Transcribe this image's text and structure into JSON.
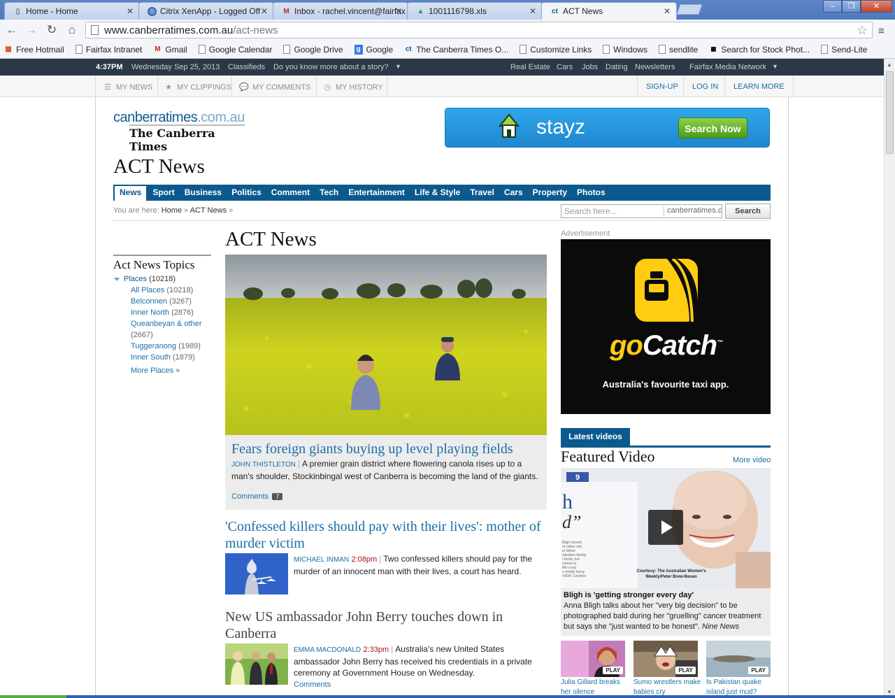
{
  "tabs": [
    {
      "title": "Home - Home",
      "icon": "doc-icon"
    },
    {
      "title": "Citrix XenApp - Logged Off",
      "icon": "citrix-icon"
    },
    {
      "title": "Inbox - rachel.vincent@fairfax",
      "icon": "gmail-icon"
    },
    {
      "title": "1001116798.xls",
      "icon": "drive-icon"
    },
    {
      "title": "ACT News",
      "icon": "ct-icon"
    }
  ],
  "address": {
    "host": "www.canberratimes.com.au",
    "path": "/act-news"
  },
  "bookmarks": [
    "Free Hotmail",
    "Fairfax Intranet",
    "Gmail",
    "Google Calendar",
    "Google Drive",
    "Google",
    "The Canberra Times O...",
    "Customize Links",
    "Windows",
    "sendlite",
    "Search for Stock Phot...",
    "Send-Lite"
  ],
  "topbar": {
    "time": "4:37PM",
    "date": "Wednesday Sep 25, 2013",
    "classifieds": "Classifieds",
    "story": "Do you know more about a story?",
    "links": [
      "Real Estate",
      "Cars",
      "Jobs",
      "Dating",
      "Newsletters"
    ],
    "network": "Fairfax Media Network"
  },
  "userbar": {
    "items": [
      "MY NEWS",
      "MY CLIPPINGS",
      "MY COMMENTS",
      "MY HISTORY"
    ],
    "signup": "SIGN-UP",
    "login": "LOG IN",
    "learn": "LEARN MORE"
  },
  "logo": {
    "domain": "canberratimes",
    "tld": ".com.au",
    "masthead": "The Canberra Times"
  },
  "stayz": {
    "brand": "stayz",
    "cta": "Search Now"
  },
  "section_title": "ACT News",
  "nav": [
    "News",
    "Sport",
    "Business",
    "Politics",
    "Comment",
    "Tech",
    "Entertainment",
    "Life & Style",
    "Travel",
    "Cars",
    "Property",
    "Photos"
  ],
  "breadcrumb": {
    "prefix": "You are here:",
    "home": "Home",
    "current": "ACT News"
  },
  "search": {
    "placeholder": "Search here...",
    "site": "canberratimes.com.au",
    "button": "Search"
  },
  "topics": {
    "heading": "Act News Topics",
    "places_label": "Places",
    "places_count": "(10218)",
    "items": [
      {
        "label": "All Places",
        "count": "(10218)"
      },
      {
        "label": "Belconnen",
        "count": "(3267)"
      },
      {
        "label": "Inner North",
        "count": "(2876)"
      },
      {
        "label": "Queanbeyan & other",
        "count": "(2667)"
      },
      {
        "label": "Tuggeranong",
        "count": "(1989)"
      },
      {
        "label": "Inner South",
        "count": "(1879)"
      }
    ],
    "more": "More Places »"
  },
  "main_title": "ACT News",
  "hero": {
    "headline": "Fears foreign giants buying up level playing fields",
    "author": "JOHN THISTLETON",
    "summary": "A premier grain district where flowering canola rises up to a man's shoulder, Stockinbingal west of Canberra is becoming the land of the giants.",
    "comments": "Comments",
    "comment_count": "7"
  },
  "stories": [
    {
      "headline": "'Confessed killers should pay with their lives': mother of murder victim",
      "author": "MICHAEL INMAN",
      "time": "2:08pm",
      "summary": "Two confessed killers should pay for the murder of an innocent man with their lives, a court has heard."
    },
    {
      "headline": "New US ambassador John Berry touches down in Canberra",
      "author": "EMMA MACDONALD",
      "time": "2:33pm",
      "summary": "Australia's new United States ambassador John Berry has received his credentials in a private ceremony at Government House on Wednesday.",
      "comments": "Comments"
    }
  ],
  "ad": {
    "label": "Advertisement",
    "brand_go": "go",
    "brand_catch": "Catch",
    "tm": "™",
    "tagline": "Australia's favourite taxi app."
  },
  "videos": {
    "tab": "Latest videos",
    "title": "Featured Video",
    "more": "More video",
    "network_badge": "9",
    "photo_credit": "Courtesy: The Australian Women's Weekly/Peter Brew-Bevan",
    "feature_title": "Bligh is 'getting stronger every day'",
    "feature_summary": "Anna Bligh talks about her \"very big decision\" to be photographed bald during her \"gruelling\" cancer treatment but says she \"just wanted to be honest\".",
    "feature_source": "Nine News",
    "play_label": "PLAY",
    "minis": [
      "Julia Gillard breaks her silence",
      "Sumo wrestlers make babies cry",
      "Is Pakistan quake island just mud?"
    ]
  },
  "colors": {
    "brand_blue": "#0b5a8d",
    "link": "#1a6fa6",
    "topbar": "#2c3846",
    "canola": "#c9cf1a",
    "gocatch_yellow": "#ffcc10"
  }
}
